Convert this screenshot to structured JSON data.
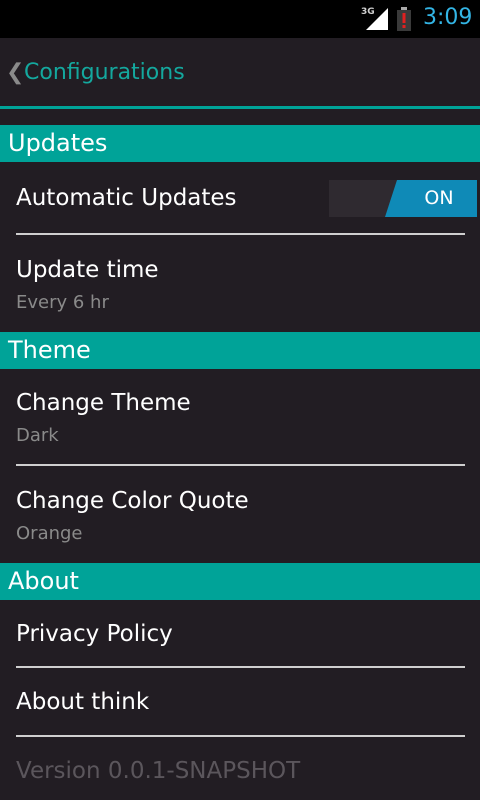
{
  "status_bar": {
    "network": "3G",
    "time": "3:09",
    "icons": [
      "signal-icon",
      "battery-alert-icon"
    ]
  },
  "action_bar": {
    "back_glyph": "❮",
    "title": "Configurations"
  },
  "sections": {
    "updates": {
      "header": "Updates",
      "automatic_updates": {
        "title": "Automatic Updates",
        "toggle_label": "ON",
        "enabled": true
      },
      "update_time": {
        "title": "Update time",
        "summary": "Every 6 hr"
      }
    },
    "theme": {
      "header": "Theme",
      "change_theme": {
        "title": "Change Theme",
        "summary": "Dark"
      },
      "change_color_quote": {
        "title": "Change Color Quote",
        "summary": "Orange"
      }
    },
    "about": {
      "header": "About",
      "privacy_policy": {
        "title": "Privacy Policy"
      },
      "about_think": {
        "title": "About think"
      },
      "version": "Version 0.0.1-SNAPSHOT"
    }
  },
  "colors": {
    "accent": "#00a398",
    "title": "#14a89e",
    "toggle_on": "#0f8ab7",
    "clock": "#33b5e5",
    "background": "#221d23"
  }
}
